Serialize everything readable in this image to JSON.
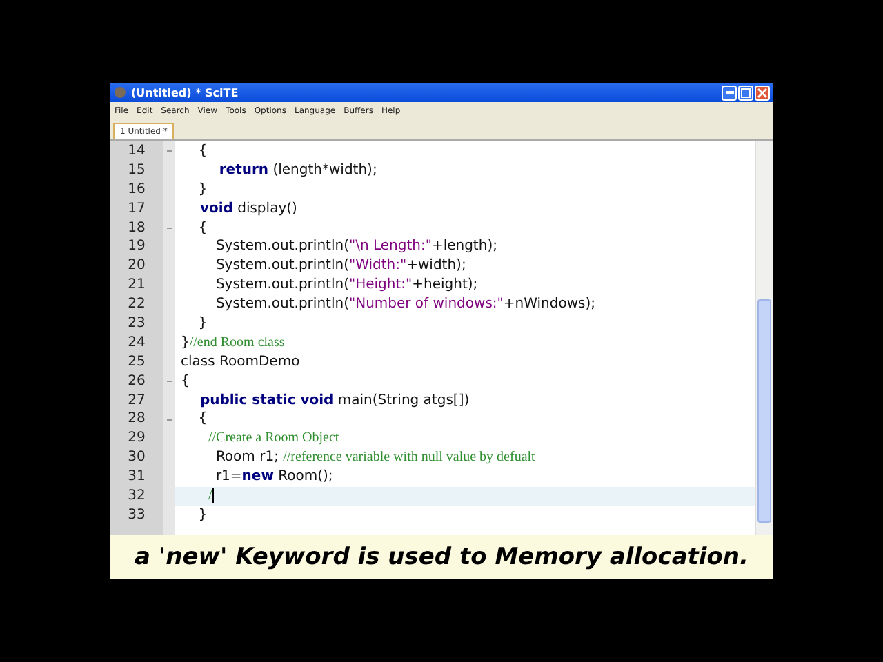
{
  "window": {
    "title": "(Untitled) * SciTE"
  },
  "menu": [
    "File",
    "Edit",
    "Search",
    "View",
    "Tools",
    "Options",
    "Language",
    "Buffers",
    "Help"
  ],
  "tabs": [
    {
      "label": "1 Untitled *",
      "selected": true
    }
  ],
  "editor": {
    "lines": [
      {
        "number": "14",
        "fold": true,
        "current": false,
        "segments": [
          {
            "kind": "plain",
            "text": "\t{"
          }
        ]
      },
      {
        "number": "15",
        "fold": false,
        "current": false,
        "segments": [
          {
            "kind": "keyword",
            "text": "\t\treturn"
          },
          {
            "kind": "plain",
            "text": " (length*width);"
          }
        ]
      },
      {
        "number": "16",
        "fold": false,
        "current": false,
        "segments": [
          {
            "kind": "plain",
            "text": "\t}"
          }
        ]
      },
      {
        "number": "17",
        "fold": false,
        "current": false,
        "segments": [
          {
            "kind": "keyword",
            "text": "\tvoid"
          },
          {
            "kind": "plain",
            "text": " display()"
          }
        ]
      },
      {
        "number": "18",
        "fold": true,
        "current": false,
        "segments": [
          {
            "kind": "plain",
            "text": "\t{"
          }
        ]
      },
      {
        "number": "19",
        "fold": false,
        "current": false,
        "segments": [
          {
            "kind": "plain",
            "text": "\t\tSystem.out.println("
          },
          {
            "kind": "string",
            "text": "\"\\n Length:\""
          },
          {
            "kind": "plain",
            "text": "+length);"
          }
        ]
      },
      {
        "number": "20",
        "fold": false,
        "current": false,
        "segments": [
          {
            "kind": "plain",
            "text": "\t\tSystem.out.println("
          },
          {
            "kind": "string",
            "text": "\"Width:\""
          },
          {
            "kind": "plain",
            "text": "+width);"
          }
        ]
      },
      {
        "number": "21",
        "fold": false,
        "current": false,
        "segments": [
          {
            "kind": "plain",
            "text": "\t\tSystem.out.println("
          },
          {
            "kind": "string",
            "text": "\"Height:\""
          },
          {
            "kind": "plain",
            "text": "+height);"
          }
        ]
      },
      {
        "number": "22",
        "fold": false,
        "current": false,
        "segments": [
          {
            "kind": "plain",
            "text": "\t\tSystem.out.println("
          },
          {
            "kind": "string",
            "text": "\"Number of windows:\""
          },
          {
            "kind": "plain",
            "text": "+nWindows);"
          }
        ]
      },
      {
        "number": "23",
        "fold": false,
        "current": false,
        "segments": [
          {
            "kind": "plain",
            "text": "\t}"
          }
        ]
      },
      {
        "number": "24",
        "fold": false,
        "current": false,
        "segments": [
          {
            "kind": "plain",
            "text": "}"
          },
          {
            "kind": "comment",
            "text": "//end Room class"
          }
        ]
      },
      {
        "number": "25",
        "fold": false,
        "current": false,
        "segments": [
          {
            "kind": "plain",
            "text": "class RoomDemo"
          }
        ]
      },
      {
        "number": "26",
        "fold": true,
        "current": false,
        "segments": [
          {
            "kind": "plain",
            "text": "{"
          }
        ]
      },
      {
        "number": "27",
        "fold": false,
        "current": false,
        "segments": [
          {
            "kind": "keyword",
            "text": "\tpublic static void"
          },
          {
            "kind": "plain",
            "text": " main(String atgs[])"
          }
        ]
      },
      {
        "number": "28",
        "fold": true,
        "current": false,
        "segments": [
          {
            "kind": "plain",
            "text": "\t{"
          }
        ]
      },
      {
        "number": "29",
        "fold": false,
        "current": false,
        "segments": [
          {
            "kind": "comment",
            "text": "\t\t//Create a Room Object"
          }
        ]
      },
      {
        "number": "30",
        "fold": false,
        "current": false,
        "segments": [
          {
            "kind": "plain",
            "text": "\t\tRoom r1; "
          },
          {
            "kind": "comment",
            "text": "//reference variable with null value by defualt"
          }
        ]
      },
      {
        "number": "31",
        "fold": false,
        "current": false,
        "segments": [
          {
            "kind": "plain",
            "text": "\t\tr1="
          },
          {
            "kind": "keyword",
            "text": "new"
          },
          {
            "kind": "plain",
            "text": " Room();"
          }
        ]
      },
      {
        "number": "32",
        "fold": false,
        "current": true,
        "segments": [
          {
            "kind": "comment",
            "text": "\t\t/"
          }
        ]
      },
      {
        "number": "33",
        "fold": false,
        "current": false,
        "segments": [
          {
            "kind": "plain",
            "text": "\t}"
          }
        ]
      }
    ]
  },
  "caption": "a 'new' Keyword is used to Memory allocation."
}
